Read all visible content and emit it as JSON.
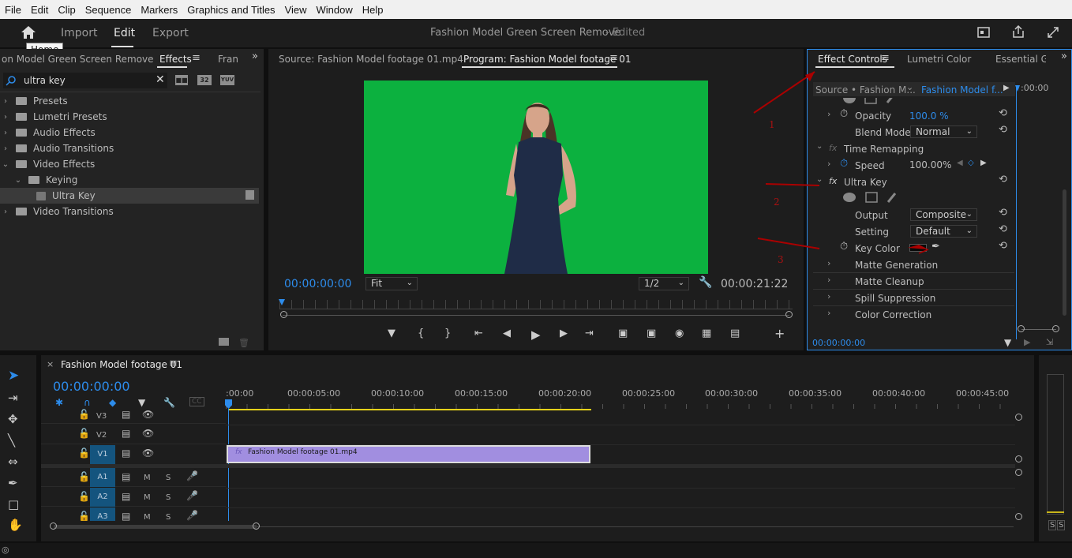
{
  "menu": [
    "File",
    "Edit",
    "Clip",
    "Sequence",
    "Markers",
    "Graphics and Titles",
    "View",
    "Window",
    "Help"
  ],
  "header": {
    "nav": {
      "import": "Import",
      "edit": "Edit",
      "export": "Export"
    },
    "project_title": "Fashion Model Green Screen Remove",
    "status": "- Edited",
    "home_tooltip": "Home"
  },
  "left_panel": {
    "tabs": {
      "project": "on Model Green Screen Remove",
      "effects": "Effects",
      "frames": "Fran"
    },
    "search": {
      "value": "ultra key"
    },
    "badges": [
      "32",
      "YUV"
    ],
    "tree": [
      {
        "label": "Presets"
      },
      {
        "label": "Lumetri Presets"
      },
      {
        "label": "Audio Effects"
      },
      {
        "label": "Audio Transitions"
      },
      {
        "label": "Video Effects"
      },
      {
        "label": "Keying"
      },
      {
        "label": "Ultra Key"
      },
      {
        "label": "Video Transitions"
      }
    ]
  },
  "monitor": {
    "source_tab": "Source: Fashion Model footage 01.mp4",
    "program_tab": "Program: Fashion Model footage 01",
    "timecode_left": "00:00:00:00",
    "fit": "Fit",
    "resolution": "1/2",
    "timecode_right": "00:00:21:22",
    "video_bg": "#0cb13f"
  },
  "effect_controls": {
    "tabs": {
      "ec": "Effect Controls",
      "lumetri": "Lumetri Color",
      "essential": "Essential Gr"
    },
    "source_label": "Source • Fashion M...",
    "clip_label": "Fashion Model f...",
    "mini_time": ":00:00",
    "opacity": {
      "label": "Opacity",
      "value": "100.0 %"
    },
    "blend": {
      "label": "Blend Mode",
      "value": "Normal"
    },
    "time_remapping": "Time Remapping",
    "speed": {
      "label": "Speed",
      "value": "100.00%"
    },
    "ultra_key": "Ultra Key",
    "output": {
      "label": "Output",
      "value": "Composite"
    },
    "setting": {
      "label": "Setting",
      "value": "Default"
    },
    "key_color": {
      "label": "Key Color",
      "swatch": "#0a0a0a"
    },
    "groups": [
      "Matte Generation",
      "Matte Cleanup",
      "Spill Suppression",
      "Color Correction"
    ],
    "bottom_time": "00:00:00:00"
  },
  "annotations": [
    "1",
    "2",
    "3"
  ],
  "timeline": {
    "close": "×",
    "sequence_name": "Fashion Model footage 01",
    "timecode": "00:00:00:00",
    "ruler": [
      ":00:00",
      "00:00:05:00",
      "00:00:10:00",
      "00:00:15:00",
      "00:00:20:00",
      "00:00:25:00",
      "00:00:30:00",
      "00:00:35:00",
      "00:00:40:00",
      "00:00:45:00"
    ],
    "video_tracks": [
      "V3",
      "V2",
      "V1"
    ],
    "audio_tracks": [
      "A1",
      "A2",
      "A3"
    ],
    "mute": "M",
    "solo": "S",
    "clip_fx": "fx",
    "clip_name": "Fashion Model footage 01.mp4",
    "clip_color": "#a18ee0",
    "meter_labels": [
      "S",
      "S"
    ]
  }
}
